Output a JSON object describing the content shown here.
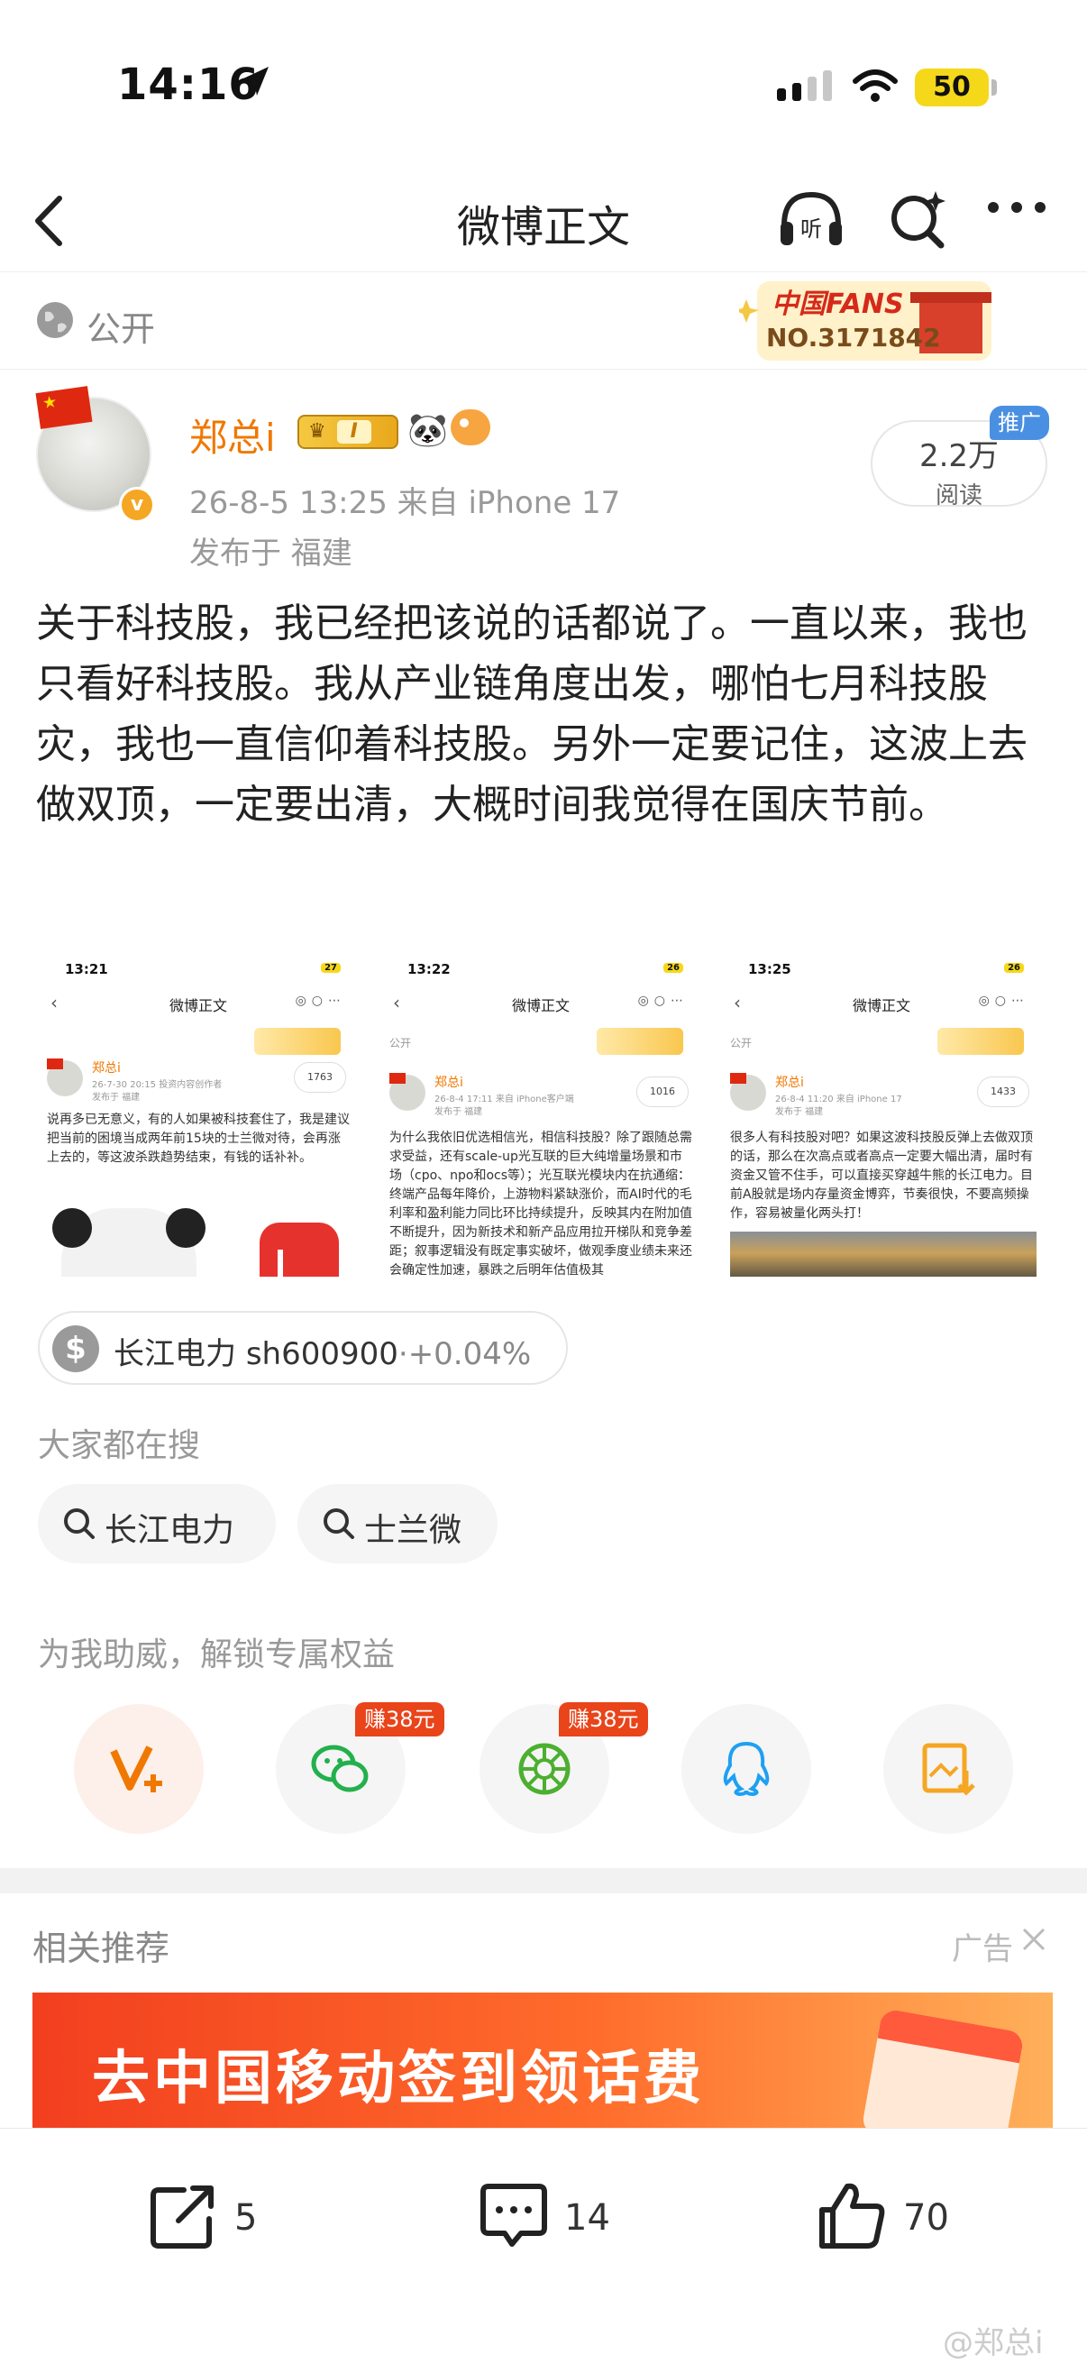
{
  "status_bar": {
    "time": "14:16",
    "battery": "50"
  },
  "nav": {
    "title": "微博正文",
    "listen_icon": "headphones-listen-icon",
    "search_icon": "search-sparkle-icon",
    "more_icon": "more-dots-icon"
  },
  "visibility": {
    "label": "公开",
    "fans_badge": {
      "title": "中国FANS",
      "number": "NO.3171842"
    }
  },
  "post": {
    "user_name": "郑总i",
    "vip_level": "I",
    "meta": "26-8-5 13:25  来自 iPhone 17",
    "location": "发布于 福建",
    "read_count": "2.2万",
    "read_label": "阅读",
    "promo_tag": "推广",
    "text": "关于科技股，我已经把该说的话都说了。一直以来，我也只看好科技股。我从产业链角度出发，哪怕七月科技股灾，我也一直信仰着科技股。另外一定要记住，这波上去做双顶，一定要出清，大概时间我觉得在国庆节前。"
  },
  "screenshots": [
    {
      "status_time": "13:21",
      "battery": "27",
      "nav_title": "微博正文",
      "user_name": "郑总i",
      "meta": "26-7-30 20:15  投资内容创作者",
      "location": "发布于 福建",
      "read": "1763",
      "text": "说再多已无意义，有的人如果被科技套住了，我是建议把当前的困境当成两年前15块的士兰微对待，会再涨上去的，等这波杀跌趋势结束，有钱的话补补。"
    },
    {
      "status_time": "13:22",
      "battery": "26",
      "nav_title": "微博正文",
      "visibility": "公开",
      "user_name": "郑总i",
      "meta": "26-8-4 17:11  来自 iPhone客户端",
      "location": "发布于 福建",
      "read": "1016",
      "text": "为什么我依旧优选相信光，相信科技股？除了跟随总需求受益，还有scale-up光互联的巨大纯增量场景和市场（cpo、npo和ocs等）；光互联光模块内在抗通缩：终端产品每年降价，上游物料紧缺涨价，而AI时代的毛利率和盈利能力同比环比持续提升，反映其内在附加值不断提升，因为新技术和新产品应用拉开梯队和竞争差距；叙事逻辑没有既定事实破坏，做观季度业绩未来还会确定性加速，暴跌之后明年估值极其"
    },
    {
      "status_time": "13:25",
      "battery": "26",
      "nav_title": "微博正文",
      "visibility": "公开",
      "user_name": "郑总i",
      "meta": "26-8-4 11:20  来自 iPhone 17",
      "location": "发布于 福建",
      "read": "1433",
      "text": "很多人有科技股对吧？如果这波科技股反弹上去做双顶的话，那么在次高点或者高点一定要大幅出清，届时有资金又管不住手，可以直接买穿越牛熊的长江电力。目前A股就是场内存量资金博弈，节奏很快，不要高频操作，容易被量化两头打！"
    }
  ],
  "stock": {
    "name": "长江电力",
    "code": "sh600900",
    "separator": "·",
    "change": "+0.04%"
  },
  "search": {
    "title": "大家都在搜",
    "items": [
      "长江电力",
      "士兰微"
    ]
  },
  "share": {
    "title": "为我助威，解锁专属权益",
    "items": [
      {
        "icon": "v-plus-icon"
      },
      {
        "icon": "wechat-icon",
        "reward": "赚38元"
      },
      {
        "icon": "moments-icon",
        "reward": "赚38元"
      },
      {
        "icon": "qq-icon"
      },
      {
        "icon": "save-image-icon"
      }
    ]
  },
  "related": {
    "title": "相关推荐",
    "ad_label": "广告",
    "banner_text": "去中国移动签到领话费"
  },
  "actions": {
    "share": "5",
    "comment": "14",
    "like": "70"
  },
  "watermark": "@郑总i",
  "colors": {
    "brand_orange": "#f07800",
    "reward_red": "#e9441a",
    "promo_blue": "#4a90e2",
    "ad_red": "#f23f1f"
  }
}
